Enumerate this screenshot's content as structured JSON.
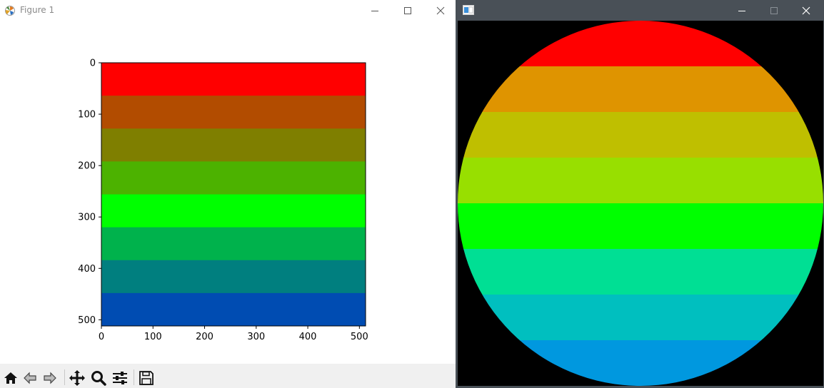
{
  "figure_window": {
    "title": "Figure 1",
    "controls": {
      "minimize": "minimize",
      "maximize": "maximize",
      "close": "close"
    },
    "toolbar": [
      {
        "name": "home-icon"
      },
      {
        "name": "back-icon"
      },
      {
        "name": "forward-icon"
      },
      {
        "name": "pan-icon"
      },
      {
        "name": "zoom-icon"
      },
      {
        "name": "configure-subplots-icon"
      },
      {
        "name": "save-icon"
      }
    ]
  },
  "image_window": {
    "title": "",
    "background": "#000000"
  },
  "chart_data": {
    "type": "heatmap",
    "title": "",
    "xlabel": "",
    "ylabel": "",
    "xlim": [
      0,
      512
    ],
    "ylim": [
      512,
      0
    ],
    "xticks": [
      0,
      100,
      200,
      300,
      400,
      500
    ],
    "yticks": [
      0,
      100,
      200,
      300,
      400,
      500
    ],
    "grid": false,
    "bands": [
      {
        "y0": 0,
        "y1": 64,
        "color": "#ff0000"
      },
      {
        "y0": 64,
        "y1": 128,
        "color": "#b24c00"
      },
      {
        "y0": 128,
        "y1": 192,
        "color": "#7f7f00"
      },
      {
        "y0": 192,
        "y1": 256,
        "color": "#4cb200"
      },
      {
        "y0": 256,
        "y1": 320,
        "color": "#00ff00"
      },
      {
        "y0": 320,
        "y1": 384,
        "color": "#00b24c"
      },
      {
        "y0": 384,
        "y1": 448,
        "color": "#007f7f"
      },
      {
        "y0": 448,
        "y1": 512,
        "color": "#004cb2"
      }
    ]
  },
  "circle_image": {
    "size": 512,
    "bands": [
      {
        "y0": 0,
        "y1": 64,
        "color": "#ff0000"
      },
      {
        "y0": 64,
        "y1": 128,
        "color": "#df9400"
      },
      {
        "y0": 128,
        "y1": 192,
        "color": "#bfbf00"
      },
      {
        "y0": 192,
        "y1": 256,
        "color": "#98df00"
      },
      {
        "y0": 256,
        "y1": 320,
        "color": "#00ff00"
      },
      {
        "y0": 320,
        "y1": 384,
        "color": "#00df94"
      },
      {
        "y0": 384,
        "y1": 448,
        "color": "#00bfbf"
      },
      {
        "y0": 448,
        "y1": 512,
        "color": "#0098df"
      }
    ]
  }
}
